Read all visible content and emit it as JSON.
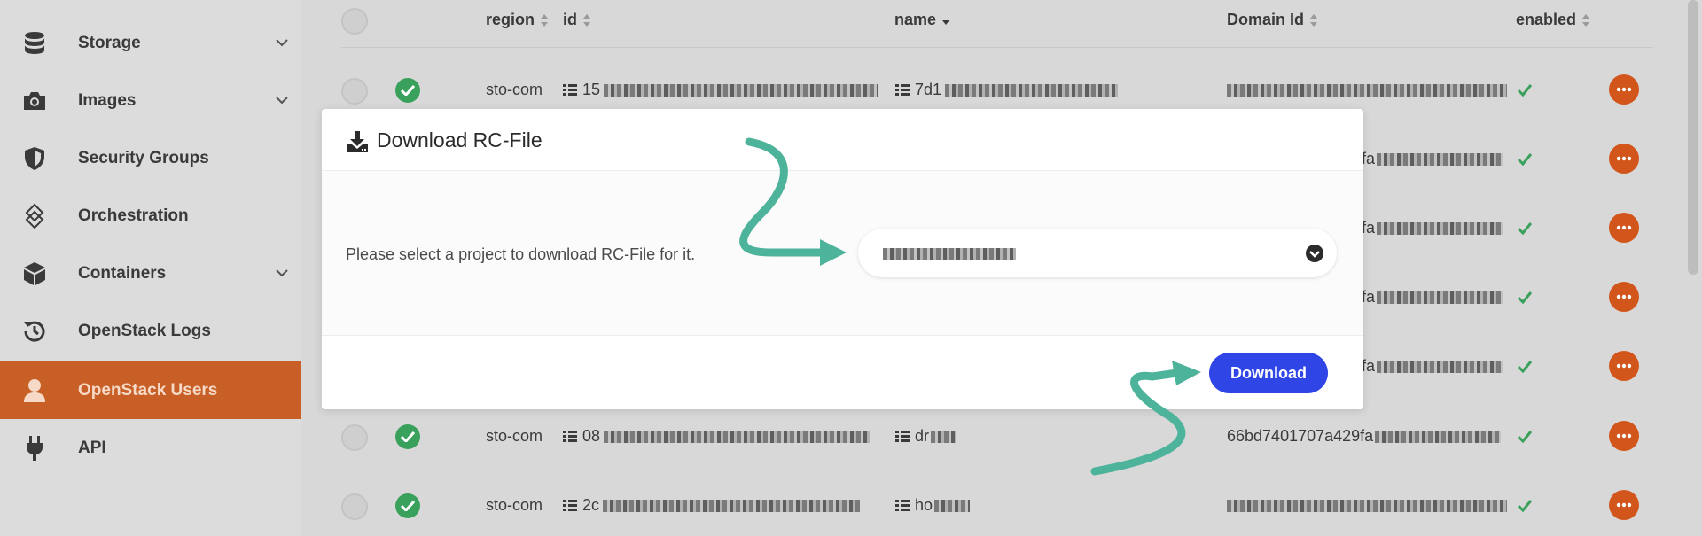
{
  "sidebar": {
    "items": [
      {
        "label": "Storage",
        "icon": "database-icon",
        "has_chevron": true
      },
      {
        "label": "Images",
        "icon": "camera-icon",
        "has_chevron": true
      },
      {
        "label": "Security Groups",
        "icon": "shield-icon",
        "has_chevron": false
      },
      {
        "label": "Orchestration",
        "icon": "orchestration-icon",
        "has_chevron": false
      },
      {
        "label": "Containers",
        "icon": "cube-icon",
        "has_chevron": true
      },
      {
        "label": "OpenStack Logs",
        "icon": "history-icon",
        "has_chevron": false
      },
      {
        "label": "OpenStack Users",
        "icon": "user-icon",
        "has_chevron": false,
        "active": true
      },
      {
        "label": "API",
        "icon": "plug-icon",
        "has_chevron": false
      }
    ]
  },
  "table": {
    "columns": [
      "region",
      "id",
      "name",
      "Domain Id",
      "enabled"
    ],
    "rows": [
      {
        "region": "sto-com",
        "id": "15",
        "name": "7d1",
        "domain_id": ""
      },
      {
        "region": "",
        "id": "",
        "name": "",
        "domain_id": "fa"
      },
      {
        "region": "",
        "id": "",
        "name": "",
        "domain_id": "fa"
      },
      {
        "region": "",
        "id": "",
        "name": "",
        "domain_id": "fa"
      },
      {
        "region": "",
        "id": "",
        "name": "",
        "domain_id": "fa"
      },
      {
        "region": "sto-com",
        "id": "08",
        "name": "dr",
        "domain_id": "66bd7401707a429fa"
      },
      {
        "region": "sto-com",
        "id": "2c",
        "name": "ho",
        "domain_id": ""
      }
    ]
  },
  "modal": {
    "title": "Download RC-File",
    "prompt": "Please select a project to download RC-File for it.",
    "select_value": "",
    "download_label": "Download"
  },
  "colors": {
    "accent": "#c75f27",
    "primary_button": "#2f45e6",
    "arrow": "#4db39a",
    "success": "#3aa15c",
    "action": "#d2561c"
  }
}
